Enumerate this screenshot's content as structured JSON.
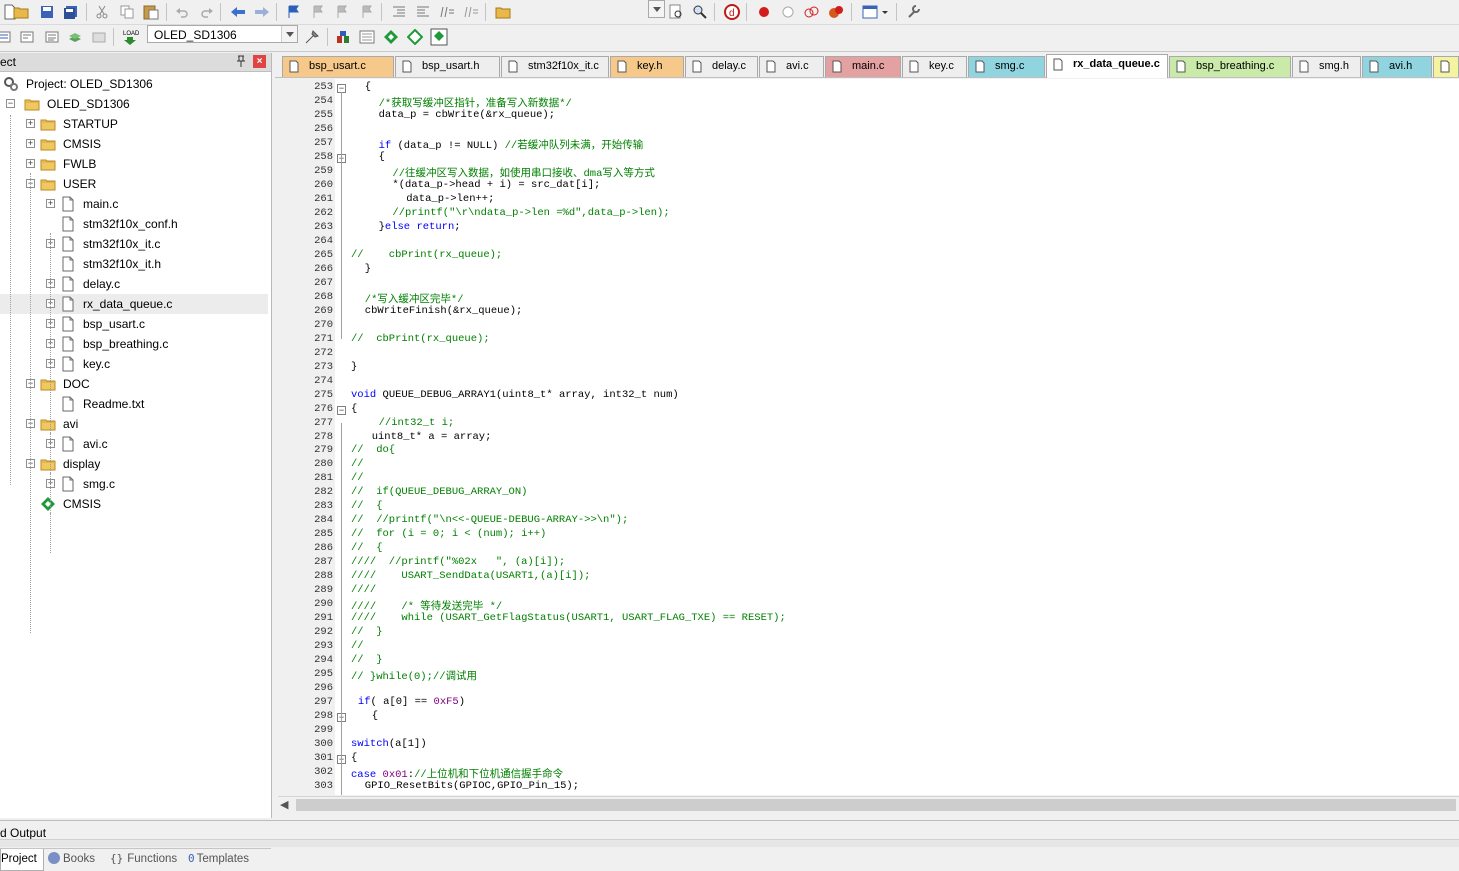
{
  "toolbar": {
    "target_combo": "OLED_SD1306"
  },
  "left_panel": {
    "title": "ect",
    "tree": [
      {
        "label": "Project: OLED_SD1306",
        "level": 0,
        "icon": "project-icon",
        "expander": "none"
      },
      {
        "label": "OLED_SD1306",
        "level": 0,
        "icon": "folder-icon",
        "expander": "minus"
      },
      {
        "label": "STARTUP",
        "level": 1,
        "icon": "folder-icon",
        "expander": "plus"
      },
      {
        "label": "CMSIS",
        "level": 1,
        "icon": "folder-icon",
        "expander": "plus"
      },
      {
        "label": "FWLB",
        "level": 1,
        "icon": "folder-icon",
        "expander": "plus"
      },
      {
        "label": "USER",
        "level": 1,
        "icon": "folder-icon",
        "expander": "minus"
      },
      {
        "label": "main.c",
        "level": 2,
        "icon": "file-icon",
        "expander": "plus"
      },
      {
        "label": "stm32f10x_conf.h",
        "level": 2,
        "icon": "file-icon",
        "expander": "none"
      },
      {
        "label": "stm32f10x_it.c",
        "level": 2,
        "icon": "file-icon",
        "expander": "plus"
      },
      {
        "label": "stm32f10x_it.h",
        "level": 2,
        "icon": "file-icon",
        "expander": "none"
      },
      {
        "label": "delay.c",
        "level": 2,
        "icon": "file-icon",
        "expander": "plus"
      },
      {
        "label": "rx_data_queue.c",
        "level": 2,
        "icon": "file-icon",
        "expander": "plus",
        "selected": true
      },
      {
        "label": "bsp_usart.c",
        "level": 2,
        "icon": "file-icon",
        "expander": "plus"
      },
      {
        "label": "bsp_breathing.c",
        "level": 2,
        "icon": "file-icon",
        "expander": "plus"
      },
      {
        "label": "key.c",
        "level": 2,
        "icon": "file-icon",
        "expander": "plus"
      },
      {
        "label": "DOC",
        "level": 1,
        "icon": "folder-icon",
        "expander": "minus"
      },
      {
        "label": "Readme.txt",
        "level": 2,
        "icon": "file-icon",
        "expander": "none"
      },
      {
        "label": "avi",
        "level": 1,
        "icon": "folder-icon",
        "expander": "minus"
      },
      {
        "label": "avi.c",
        "level": 2,
        "icon": "file-icon",
        "expander": "plus"
      },
      {
        "label": "display",
        "level": 1,
        "icon": "folder-icon",
        "expander": "minus"
      },
      {
        "label": "smg.c",
        "level": 2,
        "icon": "file-icon",
        "expander": "plus"
      },
      {
        "label": "CMSIS",
        "level": 1,
        "icon": "component-icon",
        "expander": "none"
      }
    ],
    "bottom_tabs": [
      {
        "label": "Project",
        "icon": ""
      },
      {
        "label": "Books",
        "icon": "books-icon"
      },
      {
        "label": "Functions",
        "icon": "functions-icon"
      },
      {
        "label": "Templates",
        "icon": "templates-icon"
      }
    ]
  },
  "editor_tabs": [
    {
      "label": "bsp_usart.c",
      "color": "#f6c98b"
    },
    {
      "label": "bsp_usart.h",
      "color": "#eeeeee"
    },
    {
      "label": "stm32f10x_it.c",
      "color": "#eeeeee"
    },
    {
      "label": "key.h",
      "color": "#f6c98b"
    },
    {
      "label": "delay.c",
      "color": "#eeeeee"
    },
    {
      "label": "avi.c",
      "color": "#eeeeee"
    },
    {
      "label": "main.c",
      "color": "#e3a1a1"
    },
    {
      "label": "key.c",
      "color": "#eeeeee"
    },
    {
      "label": "smg.c",
      "color": "#8fd4de"
    },
    {
      "label": "rx_data_queue.c",
      "color": "#ffffff",
      "active": true
    },
    {
      "label": "bsp_breathing.c",
      "color": "#c9eaa8"
    },
    {
      "label": "smg.h",
      "color": "#eeeeee"
    },
    {
      "label": "avi.h",
      "color": "#8fd4de"
    },
    {
      "label": "",
      "color": "#f3f3a0"
    }
  ],
  "code": {
    "first_line": 253,
    "lines": [
      {
        "n": "253",
        "fold": "minus",
        "indent": 2,
        "segs": [
          [
            "",
            "{"
          ]
        ]
      },
      {
        "n": "254",
        "indent": 4,
        "segs": [
          [
            "cm",
            "/*获取写缓冲区指针，准备写入新数据*/"
          ]
        ]
      },
      {
        "n": "255",
        "indent": 4,
        "segs": [
          [
            "",
            "data_p = cbWrite(&rx_queue);"
          ]
        ]
      },
      {
        "n": "256",
        "indent": 0,
        "segs": []
      },
      {
        "n": "257",
        "indent": 4,
        "segs": [
          [
            "kw",
            "if"
          ],
          [
            "",
            " (data_p != NULL) "
          ],
          [
            "cm",
            "//若缓冲队列未满，开始传输"
          ]
        ]
      },
      {
        "n": "258",
        "fold": "minus",
        "indent": 4,
        "segs": [
          [
            "",
            "{"
          ]
        ]
      },
      {
        "n": "259",
        "indent": 6,
        "segs": [
          [
            "cm",
            "//往缓冲区写入数据，如使用串口接收、dma写入等方式"
          ]
        ]
      },
      {
        "n": "260",
        "indent": 6,
        "segs": [
          [
            "",
            "*(data_p->head + i) = src_dat[i];"
          ]
        ]
      },
      {
        "n": "261",
        "indent": 8,
        "segs": [
          [
            "",
            "data_p->len++;"
          ]
        ]
      },
      {
        "n": "262",
        "indent": 6,
        "segs": [
          [
            "cm",
            "//printf(\"\\r\\ndata_p->len =%d\",data_p->len);"
          ]
        ]
      },
      {
        "n": "263",
        "indent": 4,
        "segs": [
          [
            "",
            "}"
          ],
          [
            "kw",
            "else"
          ],
          [
            "",
            " "
          ],
          [
            "kw",
            "return"
          ],
          [
            "",
            ";"
          ]
        ]
      },
      {
        "n": "264",
        "indent": 0,
        "segs": []
      },
      {
        "n": "265",
        "indent": 0,
        "segs": [
          [
            "cm",
            "//    cbPrint(rx_queue);"
          ]
        ]
      },
      {
        "n": "266",
        "indent": 2,
        "segs": [
          [
            "",
            "}"
          ]
        ]
      },
      {
        "n": "267",
        "indent": 0,
        "segs": []
      },
      {
        "n": "268",
        "indent": 2,
        "segs": [
          [
            "cm",
            "/*写入缓冲区完毕*/"
          ]
        ]
      },
      {
        "n": "269",
        "indent": 2,
        "segs": [
          [
            "",
            "cbWriteFinish(&rx_queue);"
          ]
        ]
      },
      {
        "n": "270",
        "indent": 0,
        "segs": []
      },
      {
        "n": "271",
        "indent": 0,
        "segs": [
          [
            "cm",
            "//  cbPrint(rx_queue);"
          ]
        ]
      },
      {
        "n": "272",
        "indent": 0,
        "segs": []
      },
      {
        "n": "273",
        "indent": 0,
        "segs": [
          [
            "",
            "}"
          ]
        ]
      },
      {
        "n": "274",
        "indent": 0,
        "segs": []
      },
      {
        "n": "275",
        "indent": 0,
        "segs": [
          [
            "kw",
            "void"
          ],
          [
            "",
            " QUEUE_DEBUG_ARRAY1(uint8_t* array, int32_t num)"
          ]
        ]
      },
      {
        "n": "276",
        "fold": "minus",
        "indent": 0,
        "segs": [
          [
            "",
            "{"
          ]
        ]
      },
      {
        "n": "277",
        "indent": 4,
        "segs": [
          [
            "cm",
            "//int32_t i;"
          ]
        ]
      },
      {
        "n": "278",
        "indent": 3,
        "segs": [
          [
            "",
            "uint8_t* a = array;"
          ]
        ]
      },
      {
        "n": "279",
        "indent": 0,
        "segs": [
          [
            "cm",
            "//  do{"
          ]
        ]
      },
      {
        "n": "280",
        "indent": 0,
        "segs": [
          [
            "cm",
            "//"
          ]
        ]
      },
      {
        "n": "281",
        "indent": 0,
        "segs": [
          [
            "cm",
            "//"
          ]
        ]
      },
      {
        "n": "282",
        "indent": 0,
        "segs": [
          [
            "cm",
            "//  if(QUEUE_DEBUG_ARRAY_ON)"
          ]
        ]
      },
      {
        "n": "283",
        "indent": 0,
        "segs": [
          [
            "cm",
            "//  {"
          ]
        ]
      },
      {
        "n": "284",
        "indent": 0,
        "segs": [
          [
            "cm",
            "//  //printf(\"\\n<<-QUEUE-DEBUG-ARRAY->>\\n\");"
          ]
        ]
      },
      {
        "n": "285",
        "indent": 0,
        "segs": [
          [
            "cm",
            "//  for (i = 0; i < (num); i++)"
          ]
        ]
      },
      {
        "n": "286",
        "indent": 0,
        "segs": [
          [
            "cm",
            "//  {"
          ]
        ]
      },
      {
        "n": "287",
        "indent": 0,
        "segs": [
          [
            "cm",
            "////  //printf(\"%02x   \", (a)[i]);"
          ]
        ]
      },
      {
        "n": "288",
        "indent": 0,
        "segs": [
          [
            "cm",
            "////    USART_SendData(USART1,(a)[i]);"
          ]
        ]
      },
      {
        "n": "289",
        "indent": 0,
        "segs": [
          [
            "cm",
            "////"
          ]
        ]
      },
      {
        "n": "290",
        "indent": 0,
        "segs": [
          [
            "cm",
            "////    /* 等待发送完毕 */"
          ]
        ]
      },
      {
        "n": "291",
        "indent": 0,
        "segs": [
          [
            "cm",
            "////    while (USART_GetFlagStatus(USART1, USART_FLAG_TXE) == RESET);"
          ]
        ]
      },
      {
        "n": "292",
        "indent": 0,
        "segs": [
          [
            "cm",
            "//  }"
          ]
        ]
      },
      {
        "n": "293",
        "indent": 0,
        "segs": [
          [
            "cm",
            "//"
          ]
        ]
      },
      {
        "n": "294",
        "indent": 0,
        "segs": [
          [
            "cm",
            "//  }"
          ]
        ]
      },
      {
        "n": "295",
        "indent": 0,
        "segs": [
          [
            "cm",
            "// }while(0);//调试用"
          ]
        ]
      },
      {
        "n": "296",
        "indent": 0,
        "segs": []
      },
      {
        "n": "297",
        "indent": 1,
        "segs": [
          [
            "kw",
            "if"
          ],
          [
            "",
            "( a[0] == "
          ],
          [
            "nb",
            "0xF5"
          ],
          [
            "",
            ")"
          ]
        ]
      },
      {
        "n": "298",
        "fold": "minus",
        "indent": 3,
        "segs": [
          [
            "",
            "{"
          ]
        ]
      },
      {
        "n": "299",
        "indent": 0,
        "segs": []
      },
      {
        "n": "300",
        "indent": 0,
        "segs": [
          [
            "kw",
            "switch"
          ],
          [
            "",
            "(a[1])"
          ]
        ]
      },
      {
        "n": "301",
        "fold": "minus",
        "indent": 0,
        "segs": [
          [
            "",
            "{"
          ]
        ]
      },
      {
        "n": "302",
        "indent": 0,
        "segs": [
          [
            "kw",
            "case"
          ],
          [
            "",
            " "
          ],
          [
            "nb",
            "0x01"
          ],
          [
            "",
            ":"
          ],
          [
            "cm",
            "//上位机和下位机通信握手命令"
          ]
        ]
      },
      {
        "n": "303",
        "indent": 2,
        "segs": [
          [
            "",
            "GPIO_ResetBits(GPIOC,GPIO_Pin_15);"
          ]
        ]
      }
    ]
  },
  "bottom_panel": {
    "title": "d Output"
  },
  "colors": {
    "keyword": "#0000ff",
    "comment": "#008000",
    "number": "#800080"
  }
}
